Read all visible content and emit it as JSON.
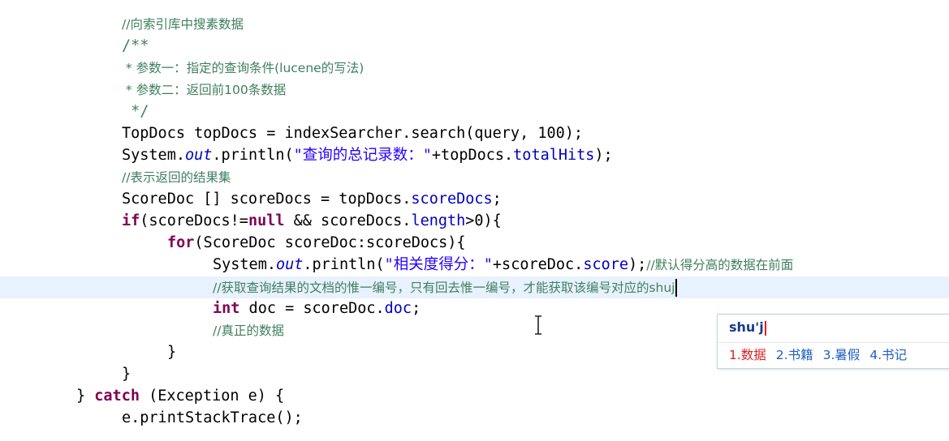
{
  "editor": {
    "lines": [
      {
        "segments": [
          {
            "t": "//向索引库中搜素数据",
            "c": "cmt"
          }
        ]
      },
      {
        "segments": [
          {
            "t": "/**",
            "c": "cmt-m"
          }
        ]
      },
      {
        "segments": [
          {
            "t": " * 参数一：指定的查询条件(lucene的写法)",
            "c": "cmt"
          }
        ]
      },
      {
        "segments": [
          {
            "t": " * 参数二：返回前100条数据",
            "c": "cmt"
          }
        ]
      },
      {
        "segments": [
          {
            "t": " */",
            "c": "cmt-m"
          }
        ]
      },
      {
        "segments": [
          {
            "t": "TopDocs topDocs = indexSearcher.search(query, 100);",
            "c": ""
          }
        ]
      },
      {
        "segments": [
          {
            "t": "System.",
            "c": ""
          },
          {
            "t": "out",
            "c": "sfld"
          },
          {
            "t": ".println(",
            "c": ""
          },
          {
            "t": "\"查询的总记录数：\"",
            "c": "str"
          },
          {
            "t": "+topDocs.",
            "c": ""
          },
          {
            "t": "totalHits",
            "c": "fld"
          },
          {
            "t": ");",
            "c": ""
          }
        ]
      },
      {
        "segments": [
          {
            "t": "//表示返回的结果集",
            "c": "cmt"
          }
        ]
      },
      {
        "segments": [
          {
            "t": "ScoreDoc [] scoreDocs = topDocs.",
            "c": ""
          },
          {
            "t": "scoreDocs",
            "c": "fld"
          },
          {
            "t": ";",
            "c": ""
          }
        ]
      },
      {
        "segments": [
          {
            "t": "if",
            "c": "kw"
          },
          {
            "t": "(scoreDocs!=",
            "c": ""
          },
          {
            "t": "null",
            "c": "kw"
          },
          {
            "t": " && scoreDocs.",
            "c": ""
          },
          {
            "t": "length",
            "c": "fld"
          },
          {
            "t": ">0){",
            "c": ""
          }
        ]
      },
      {
        "segments": [
          {
            "t": "for",
            "c": "kw"
          },
          {
            "t": "(ScoreDoc scoreDoc:scoreDocs){",
            "c": ""
          }
        ]
      },
      {
        "segments": [
          {
            "t": "System.",
            "c": ""
          },
          {
            "t": "out",
            "c": "sfld"
          },
          {
            "t": ".println(",
            "c": ""
          },
          {
            "t": "\"相关度得分：\"",
            "c": "str"
          },
          {
            "t": "+scoreDoc.",
            "c": ""
          },
          {
            "t": "score",
            "c": "fld"
          },
          {
            "t": ");",
            "c": ""
          },
          {
            "t": "//默认得分高的数据在前面",
            "c": "cmt"
          }
        ]
      },
      {
        "segments": [
          {
            "t": "//获取查询结果的文档的惟一编号，只有回去惟一编号，才能获取该编号对应的shuj",
            "c": "cmt"
          }
        ]
      },
      {
        "segments": [
          {
            "t": "int",
            "c": "kw"
          },
          {
            "t": " doc = scoreDoc.",
            "c": ""
          },
          {
            "t": "doc",
            "c": "fld"
          },
          {
            "t": ";",
            "c": ""
          }
        ]
      },
      {
        "segments": [
          {
            "t": "//真正的数据",
            "c": "cmt"
          }
        ]
      },
      {
        "segments": [
          {
            "t": "}",
            "c": ""
          }
        ]
      },
      {
        "segments": [
          {
            "t": "}",
            "c": ""
          }
        ]
      },
      {
        "segments": [
          {
            "t": "} ",
            "c": ""
          },
          {
            "t": "catch",
            "c": "kw"
          },
          {
            "t": " (Exception e) {",
            "c": ""
          }
        ]
      },
      {
        "segments": [
          {
            "t": "e.printStackTrace();",
            "c": ""
          }
        ]
      }
    ]
  },
  "ime": {
    "input": "shu'j",
    "candidates": [
      {
        "label": "1.数据",
        "selected": true
      },
      {
        "label": "2.书籍",
        "selected": false
      },
      {
        "label": "3.暑假",
        "selected": false
      },
      {
        "label": "4.书记",
        "selected": false
      }
    ]
  }
}
